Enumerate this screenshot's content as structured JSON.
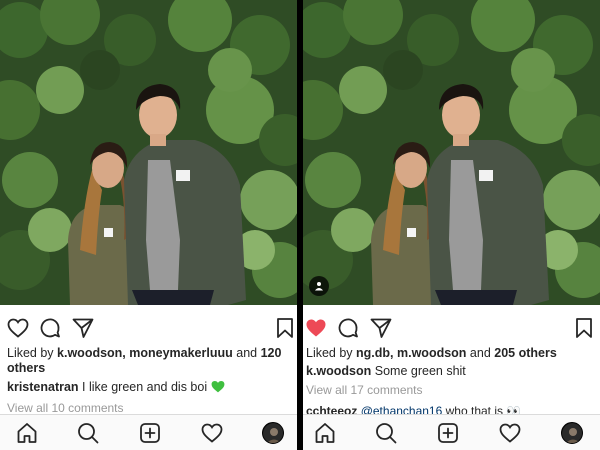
{
  "left_post": {
    "liked": false,
    "likes": {
      "prefix": "Liked by ",
      "names": "k.woodson, moneymakerluuu",
      "connector": " and ",
      "others": "120 others"
    },
    "caption": {
      "username": "kristenatran",
      "text": " I like green and dis boi ",
      "emoji": "green-heart-icon"
    },
    "view_comments": "View all 10 comments"
  },
  "right_post": {
    "liked": true,
    "likes": {
      "prefix": "Liked by ",
      "names": "ng.db, m.woodson",
      "connector": " and ",
      "others": "205 others"
    },
    "caption": {
      "username": "k.woodson",
      "text": " Some green shit"
    },
    "view_comments": "View all 17 comments",
    "comment_peek": {
      "username": "cchteeoz",
      "mention": "@ethanchan16",
      "text": " who that is 👀"
    }
  },
  "action_icons": [
    "heart-icon",
    "comment-icon",
    "share-icon",
    "bookmark-icon"
  ],
  "tab_icons": [
    "home-icon",
    "search-icon",
    "new-post-icon",
    "activity-icon",
    "profile-avatar"
  ],
  "colors": {
    "liked_heart": "#ed4956",
    "text": "#262626",
    "muted": "#999999",
    "mention": "#003569",
    "tabbar_bg": "#fafafa",
    "divider": "#000000"
  }
}
